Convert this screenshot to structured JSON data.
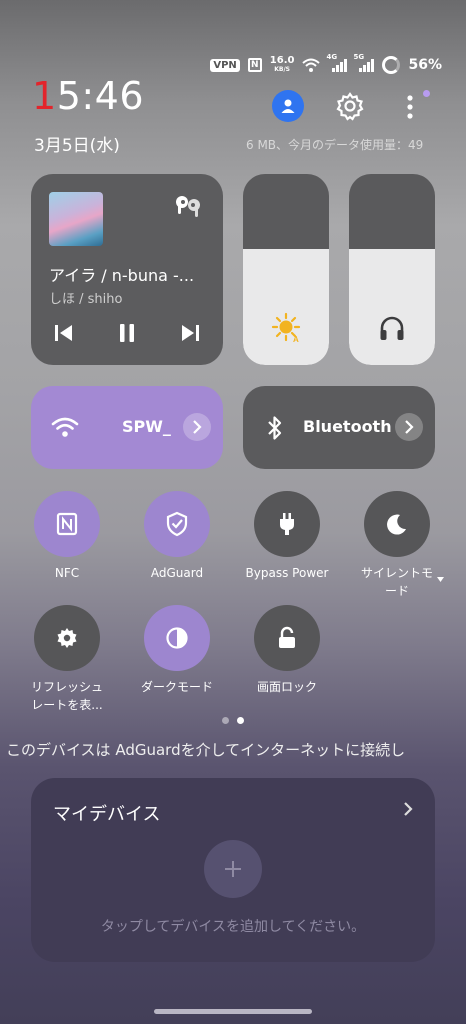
{
  "status": {
    "vpn": "VPN",
    "nfc": "N",
    "speed": "16.0",
    "speed_unit": "KB/S",
    "sig1": "4G",
    "sig2": "5G",
    "battery": "56%"
  },
  "clock": {
    "time_first": "1",
    "time_rest": "5:46",
    "date": "3月5日(水)"
  },
  "data_usage": "6 MB、今月のデータ使用量：49",
  "media": {
    "title": "アイラ / n-buna -...",
    "artist": "しほ / shiho"
  },
  "sliders": {
    "brightness_level": 0.61,
    "volume_level": 0.61
  },
  "wifi": {
    "label": "SPW_",
    "icon": "wifi-icon"
  },
  "bluetooth": {
    "label": "Bluetooth",
    "icon": "bluetooth-icon"
  },
  "tiles": [
    {
      "label": "NFC",
      "on": true
    },
    {
      "label": "AdGuard",
      "on": true
    },
    {
      "label": "Bypass Power",
      "on": false
    },
    {
      "label": "サイレントモード",
      "label_line1": "サイレントモ",
      "label_line2": "ード",
      "on": false
    },
    {
      "label": "リフレッシュレートを表...",
      "label_line1": "リフレッシュ",
      "label_line2": "レートを表...",
      "on": false
    },
    {
      "label": "ダークモード",
      "on": true
    },
    {
      "label": "画面ロック",
      "on": false
    }
  ],
  "pager": {
    "current": 2,
    "total": 2
  },
  "notice": "このデバイスは AdGuardを介してインターネットに接続し",
  "devices": {
    "title": "マイデバイス",
    "hint": "タップしてデバイスを追加してください。"
  },
  "colors": {
    "active_tile": "#9d86cf",
    "clock_red": "#e3242b",
    "profile_blue": "#2f74f0"
  }
}
